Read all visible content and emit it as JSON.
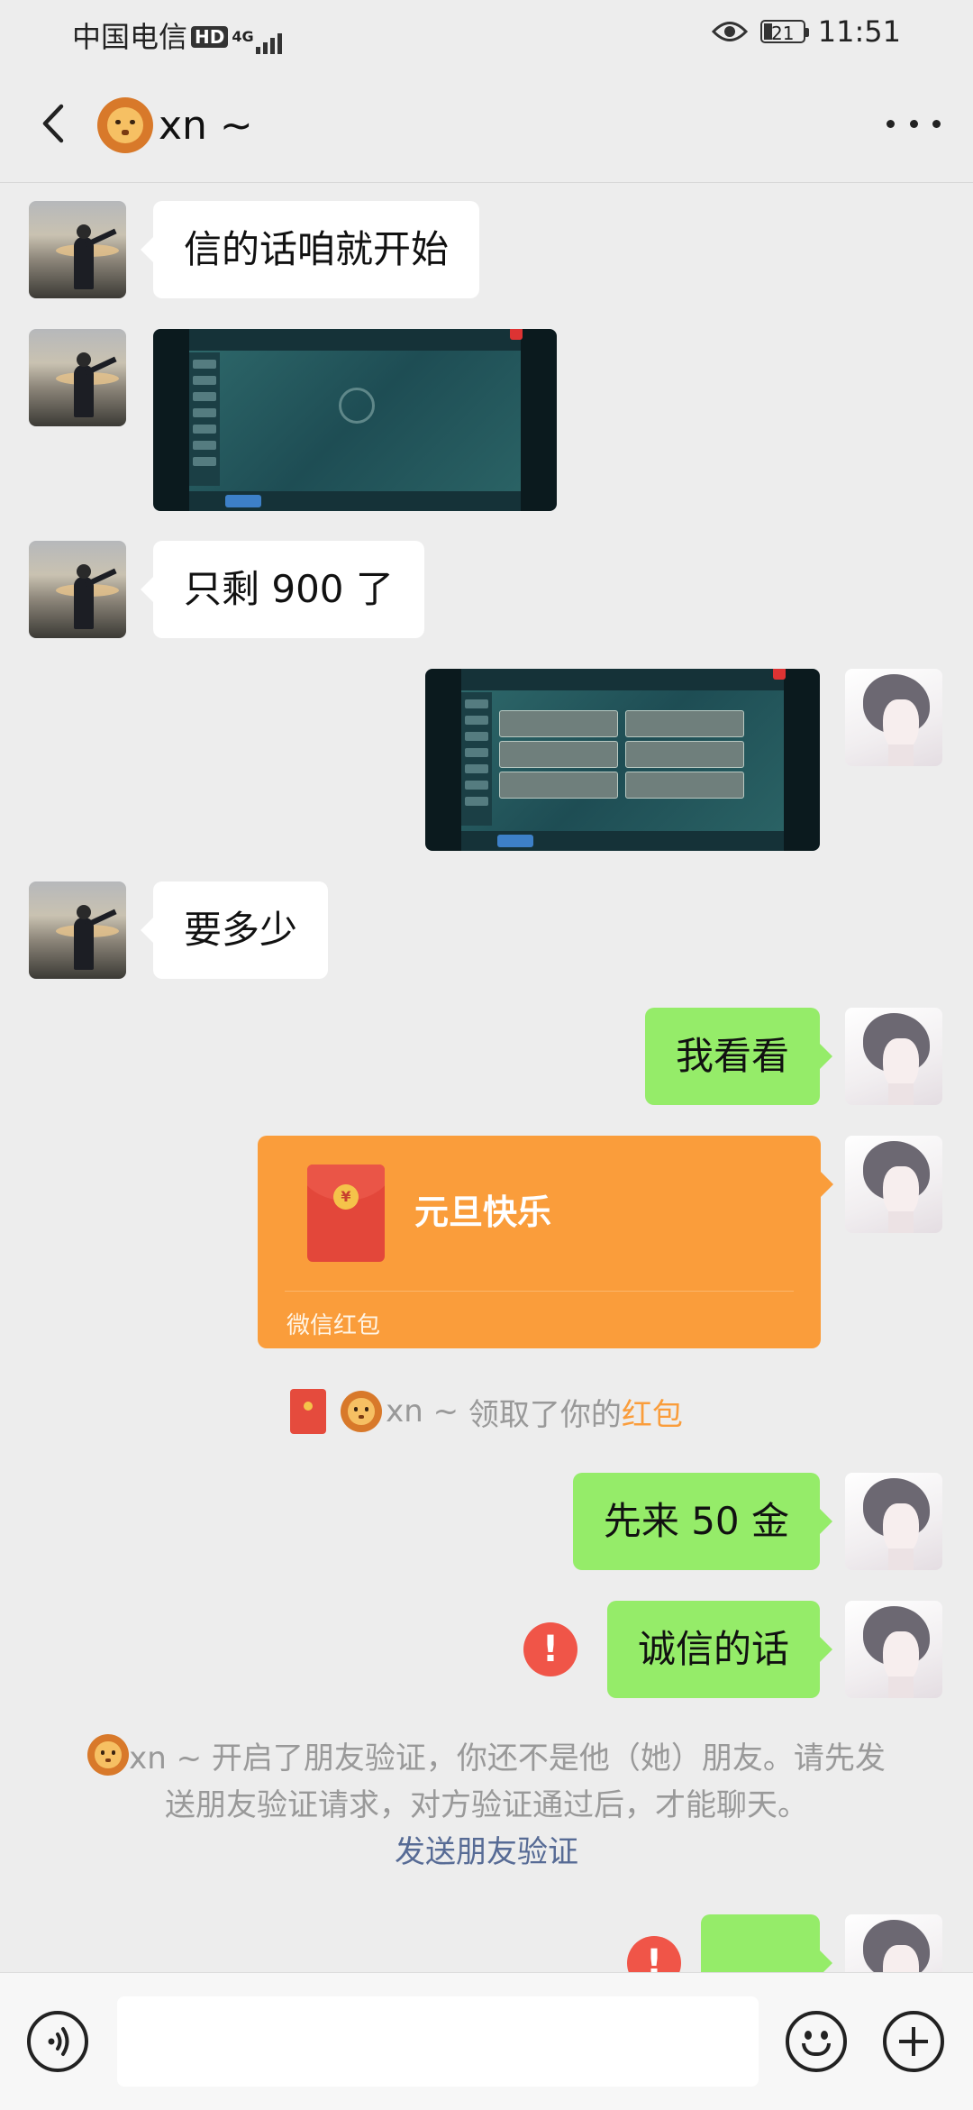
{
  "status_bar": {
    "carrier": "中国电信",
    "hd_label": "HD",
    "network": "4G",
    "battery": "21",
    "time": "11:51"
  },
  "header": {
    "contact_name": "xn ~",
    "back_icon": "chevron-left-icon",
    "more_icon": "more-dots-icon"
  },
  "messages": [
    {
      "side": "left",
      "type": "text",
      "text": "信的话咱就开始"
    },
    {
      "side": "left",
      "type": "image",
      "description_icon": "game-screenshot"
    },
    {
      "side": "left",
      "type": "text",
      "text": "只剩 900 了"
    },
    {
      "side": "right",
      "type": "image",
      "description_icon": "game-screenshot"
    },
    {
      "side": "left",
      "type": "text",
      "text": "要多少"
    },
    {
      "side": "right",
      "type": "text",
      "text": "我看看"
    },
    {
      "side": "right",
      "type": "red_packet",
      "title": "元旦快乐",
      "label": "微信红包"
    },
    {
      "side": "right",
      "type": "text",
      "text": "先来 50 金"
    },
    {
      "side": "right",
      "type": "text",
      "text": "诚信的话",
      "failed": true
    }
  ],
  "notices": {
    "red_packet_claim": {
      "name": "xn ~",
      "text": "领取了你的",
      "link": "红包"
    },
    "friend_verify": {
      "name": "xn ~",
      "text": "开启了朋友验证，你还不是他（她）朋友。请先发送朋友验证请求，对方验证通过后，才能聊天。",
      "link": "发送朋友验证"
    }
  },
  "error_symbol": "!",
  "input_bar": {
    "voice_icon": "voice-icon",
    "emoji_icon": "emoji-icon",
    "plus_icon": "plus-icon"
  },
  "colors": {
    "background": "#ededed",
    "sent_bubble": "#95ec69",
    "received_bubble": "#ffffff",
    "red_packet": "#fa9d3b",
    "error": "#f05548",
    "link": "#576b95"
  }
}
